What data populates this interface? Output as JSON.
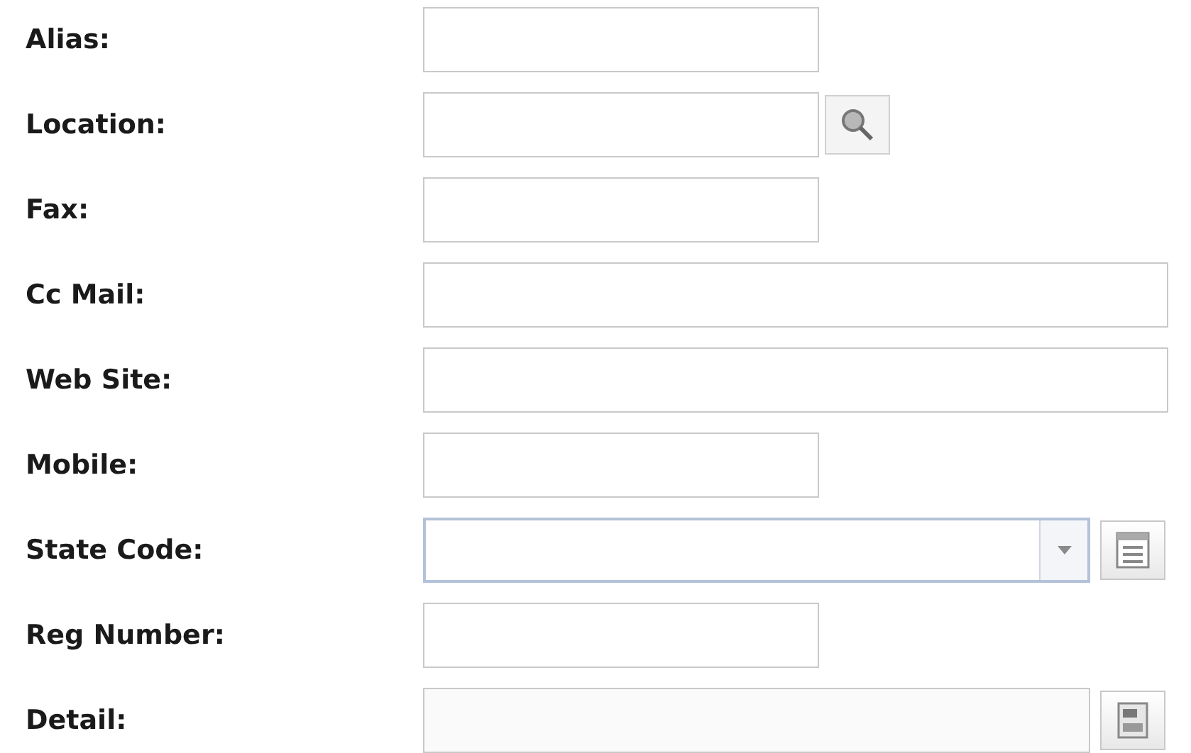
{
  "fields": [
    {
      "label": "Alias:",
      "kind": "short"
    },
    {
      "label": "Location:",
      "kind": "search"
    },
    {
      "label": "Fax:",
      "kind": "short"
    },
    {
      "label": "Cc Mail:",
      "kind": "long"
    },
    {
      "label": "Web Site:",
      "kind": "long"
    },
    {
      "label": "Mobile:",
      "kind": "short"
    },
    {
      "label": "State Code:",
      "kind": "select"
    },
    {
      "label": "Reg Number:",
      "kind": "short"
    },
    {
      "label": "Detail:",
      "kind": "memo"
    }
  ]
}
